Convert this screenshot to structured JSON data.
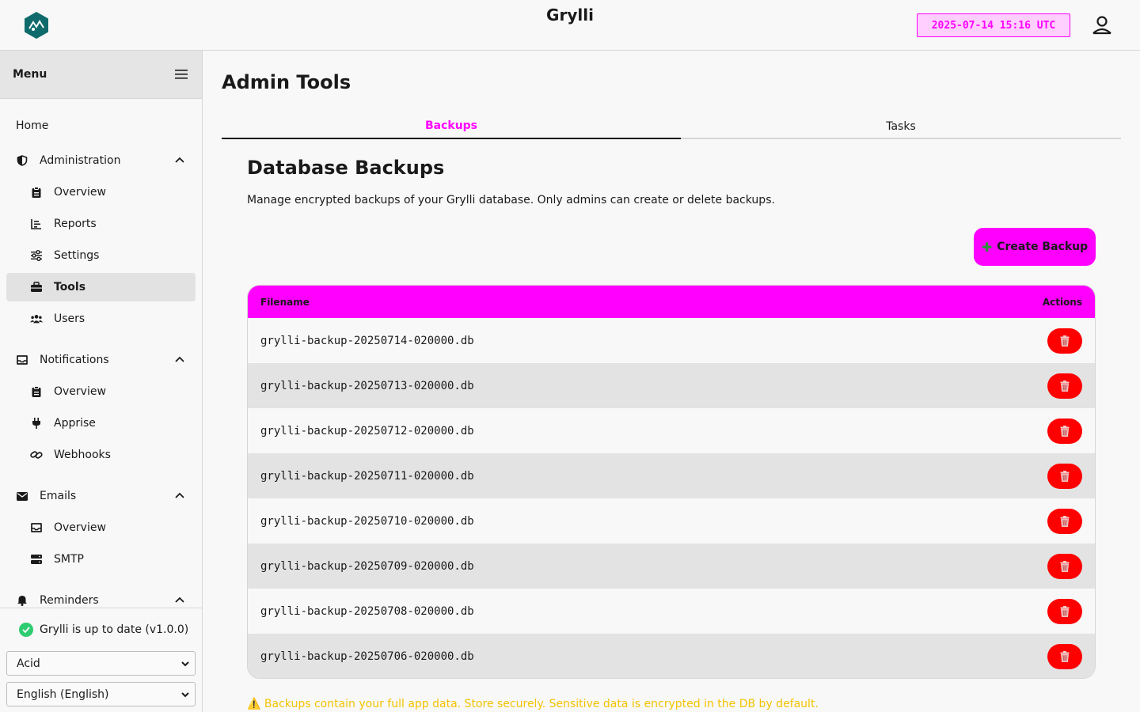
{
  "header": {
    "app_title": "Grylli",
    "datetime": "2025-07-14 15:16 UTC"
  },
  "sidebar": {
    "menu_label": "Menu",
    "items": [
      {
        "label": "Home",
        "icon": "none"
      },
      {
        "label": "Administration",
        "icon": "shield-icon",
        "expanded": true,
        "children": [
          {
            "label": "Overview",
            "icon": "clipboard-icon"
          },
          {
            "label": "Reports",
            "icon": "chart-icon"
          },
          {
            "label": "Settings",
            "icon": "sliders-icon"
          },
          {
            "label": "Tools",
            "icon": "toolbox-icon",
            "active": true
          },
          {
            "label": "Users",
            "icon": "users-icon"
          }
        ]
      },
      {
        "label": "Notifications",
        "icon": "inbox-icon",
        "expanded": true,
        "children": [
          {
            "label": "Overview",
            "icon": "clipboard-icon"
          },
          {
            "label": "Apprise",
            "icon": "plug-icon"
          },
          {
            "label": "Webhooks",
            "icon": "link-icon"
          }
        ]
      },
      {
        "label": "Emails",
        "icon": "envelope-icon",
        "expanded": true,
        "children": [
          {
            "label": "Overview",
            "icon": "inbox-icon"
          },
          {
            "label": "SMTP",
            "icon": "server-icon"
          }
        ]
      },
      {
        "label": "Reminders",
        "icon": "bell-icon",
        "expanded": true
      }
    ],
    "status_text": "Grylli is up to date (v1.0.0)",
    "theme_select": "Acid",
    "language_select": "English (English)"
  },
  "main": {
    "page_title": "Admin Tools",
    "tabs": [
      {
        "label": "Backups",
        "active": true
      },
      {
        "label": "Tasks",
        "active": false
      }
    ],
    "section_title": "Database Backups",
    "description": "Manage encrypted backups of your Grylli database. Only admins can create or delete backups.",
    "create_button": "Create Backup",
    "table": {
      "columns": [
        "Filename",
        "Actions"
      ],
      "rows": [
        "grylli-backup-20250714-020000.db",
        "grylli-backup-20250713-020000.db",
        "grylli-backup-20250712-020000.db",
        "grylli-backup-20250711-020000.db",
        "grylli-backup-20250710-020000.db",
        "grylli-backup-20250709-020000.db",
        "grylli-backup-20250708-020000.db",
        "grylli-backup-20250706-020000.db"
      ]
    },
    "warning": "⚠️ Backups contain your full app data. Store securely. Sensitive data is encrypted in the DB by default."
  },
  "colors": {
    "accent": "#ff00ff",
    "danger": "#ff0000",
    "warning": "#f3c300",
    "success": "#2ecc71"
  }
}
